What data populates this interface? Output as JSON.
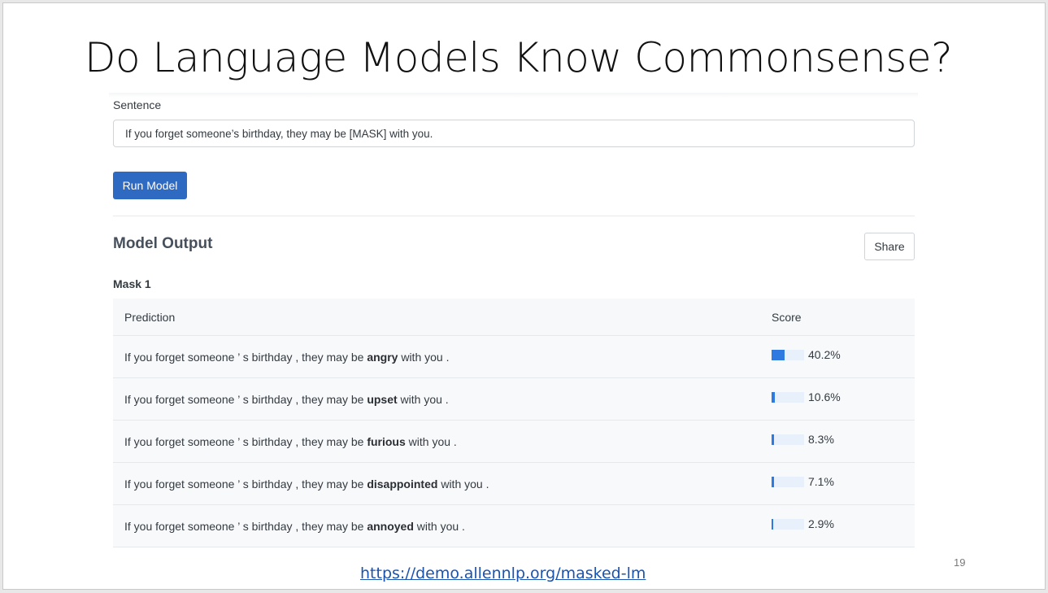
{
  "slide": {
    "title": "Do Language Models Know Commonsense?",
    "page_number": "19",
    "link": "https://demo.allennlp.org/masked-lm"
  },
  "form": {
    "sentence_label": "Sentence",
    "sentence_value": "If you forget someone’s birthday, they may be [MASK] with you.",
    "run_button": "Run Model"
  },
  "output": {
    "heading": "Model Output",
    "share_button": "Share",
    "mask_heading": "Mask 1",
    "columns": {
      "prediction": "Prediction",
      "score": "Score"
    },
    "rows": [
      {
        "prefix": "If you forget someone ’ s birthday , they may be",
        "word": "angry",
        "suffix": "with you .",
        "score_text": "40.2%",
        "score": 0.402
      },
      {
        "prefix": "If you forget someone ’ s birthday , they may be",
        "word": "upset",
        "suffix": "with you .",
        "score_text": "10.6%",
        "score": 0.106
      },
      {
        "prefix": "If you forget someone ’ s birthday , they may be",
        "word": "furious",
        "suffix": "with you .",
        "score_text": "8.3%",
        "score": 0.083
      },
      {
        "prefix": "If you forget someone ’ s birthday , they may be",
        "word": "disappointed",
        "suffix": "with you .",
        "score_text": "7.1%",
        "score": 0.071
      },
      {
        "prefix": "If you forget someone ’ s birthday , they may be",
        "word": "annoyed",
        "suffix": "with you .",
        "score_text": "2.9%",
        "score": 0.029
      }
    ]
  },
  "colors": {
    "primary_button": "#2f6ac2",
    "score_bar": "#2e7ae0",
    "score_track": "#e8f1fb",
    "link": "#1a53b0"
  }
}
